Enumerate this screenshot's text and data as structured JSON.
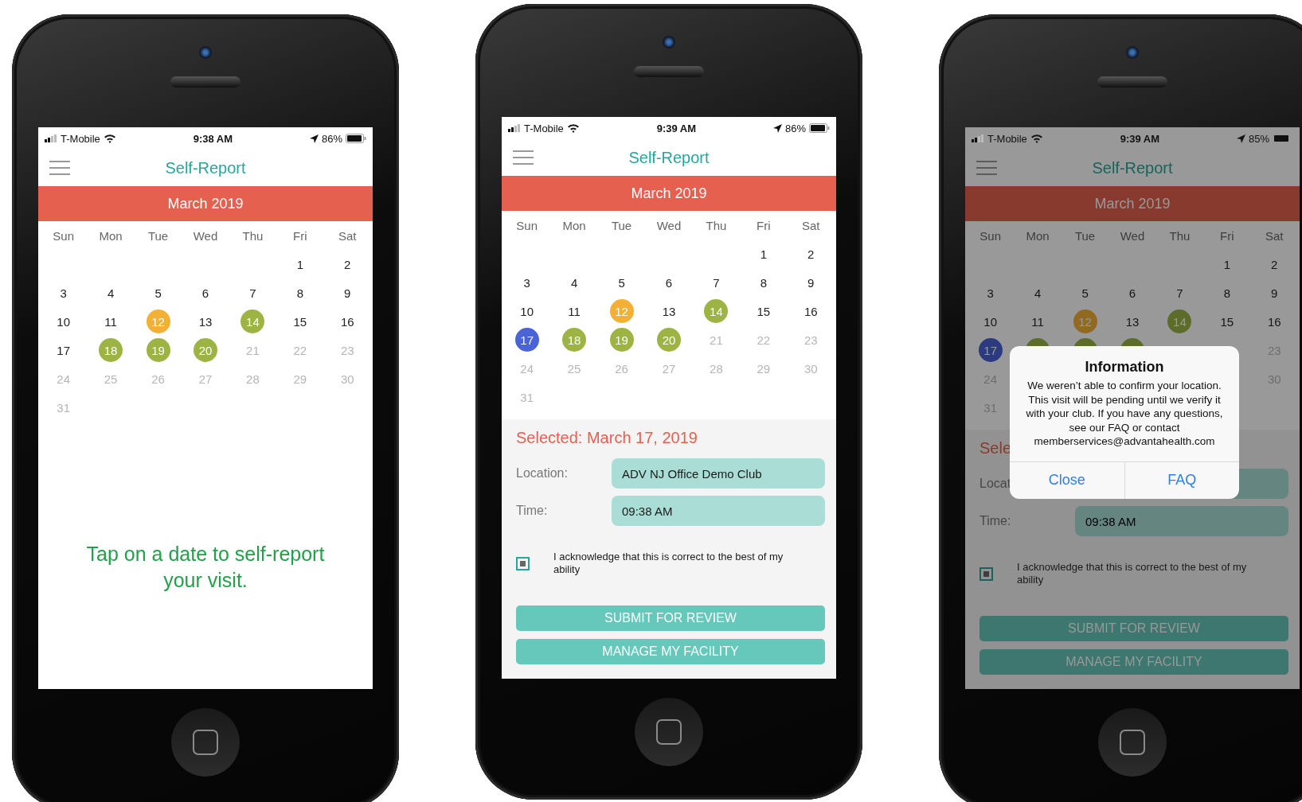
{
  "phones": [
    {
      "dimmed": false,
      "status_bar": {
        "carrier": "T-Mobile",
        "time": "9:38 AM",
        "battery": "86%"
      },
      "title": "Self-Report",
      "month": "March 2019",
      "weekdays": [
        "Sun",
        "Mon",
        "Tue",
        "Wed",
        "Thu",
        "Fri",
        "Sat"
      ],
      "weeks": [
        [
          {
            "kind": "blank"
          },
          {
            "kind": "blank"
          },
          {
            "kind": "blank"
          },
          {
            "kind": "blank"
          },
          {
            "kind": "blank"
          },
          {
            "kind": "date",
            "label": "1",
            "muted": false
          },
          {
            "kind": "date",
            "label": "2",
            "muted": false
          }
        ],
        [
          {
            "kind": "date",
            "label": "3",
            "muted": false
          },
          {
            "kind": "date",
            "label": "4",
            "muted": false
          },
          {
            "kind": "date",
            "label": "5",
            "muted": false
          },
          {
            "kind": "date",
            "label": "6",
            "muted": false
          },
          {
            "kind": "date",
            "label": "7",
            "muted": false
          },
          {
            "kind": "date",
            "label": "8",
            "muted": false
          },
          {
            "kind": "date",
            "label": "9",
            "muted": false
          }
        ],
        [
          {
            "kind": "date",
            "label": "10",
            "muted": false
          },
          {
            "kind": "date",
            "label": "11",
            "muted": false
          },
          {
            "kind": "date",
            "label": "12",
            "color": "#f2b135"
          },
          {
            "kind": "date",
            "label": "13",
            "muted": false
          },
          {
            "kind": "date",
            "label": "14",
            "color": "#9db444"
          },
          {
            "kind": "date",
            "label": "15",
            "muted": false
          },
          {
            "kind": "date",
            "label": "16",
            "muted": false
          }
        ],
        [
          {
            "kind": "date",
            "label": "17",
            "muted": false
          },
          {
            "kind": "date",
            "label": "18",
            "color": "#9db444"
          },
          {
            "kind": "date",
            "label": "19",
            "color": "#9db444"
          },
          {
            "kind": "date",
            "label": "20",
            "color": "#9db444"
          },
          {
            "kind": "date",
            "label": "21",
            "muted": true
          },
          {
            "kind": "date",
            "label": "22",
            "muted": true
          },
          {
            "kind": "date",
            "label": "23",
            "muted": true
          }
        ],
        [
          {
            "kind": "date",
            "label": "24",
            "muted": true
          },
          {
            "kind": "date",
            "label": "25",
            "muted": true
          },
          {
            "kind": "date",
            "label": "26",
            "muted": true
          },
          {
            "kind": "date",
            "label": "27",
            "muted": true
          },
          {
            "kind": "date",
            "label": "28",
            "muted": true
          },
          {
            "kind": "date",
            "label": "29",
            "muted": true
          },
          {
            "kind": "date",
            "label": "30",
            "muted": true
          }
        ],
        [
          {
            "kind": "date",
            "label": "31",
            "muted": true
          }
        ]
      ],
      "prompt": "Tap on a date to self-report your visit."
    },
    {
      "dimmed": false,
      "status_bar": {
        "carrier": "T-Mobile",
        "time": "9:39 AM",
        "battery": "86%"
      },
      "title": "Self-Report",
      "month": "March 2019",
      "weekdays": [
        "Sun",
        "Mon",
        "Tue",
        "Wed",
        "Thu",
        "Fri",
        "Sat"
      ],
      "weeks": [
        [
          {
            "kind": "blank"
          },
          {
            "kind": "blank"
          },
          {
            "kind": "blank"
          },
          {
            "kind": "blank"
          },
          {
            "kind": "blank"
          },
          {
            "kind": "date",
            "label": "1",
            "muted": false
          },
          {
            "kind": "date",
            "label": "2",
            "muted": false
          }
        ],
        [
          {
            "kind": "date",
            "label": "3",
            "muted": false
          },
          {
            "kind": "date",
            "label": "4",
            "muted": false
          },
          {
            "kind": "date",
            "label": "5",
            "muted": false
          },
          {
            "kind": "date",
            "label": "6",
            "muted": false
          },
          {
            "kind": "date",
            "label": "7",
            "muted": false
          },
          {
            "kind": "date",
            "label": "8",
            "muted": false
          },
          {
            "kind": "date",
            "label": "9",
            "muted": false
          }
        ],
        [
          {
            "kind": "date",
            "label": "10",
            "muted": false
          },
          {
            "kind": "date",
            "label": "11",
            "muted": false
          },
          {
            "kind": "date",
            "label": "12",
            "color": "#f2b135"
          },
          {
            "kind": "date",
            "label": "13",
            "muted": false
          },
          {
            "kind": "date",
            "label": "14",
            "color": "#9db444"
          },
          {
            "kind": "date",
            "label": "15",
            "muted": false
          },
          {
            "kind": "date",
            "label": "16",
            "muted": false
          }
        ],
        [
          {
            "kind": "date",
            "label": "17",
            "color": "#4a63d6"
          },
          {
            "kind": "date",
            "label": "18",
            "color": "#9db444"
          },
          {
            "kind": "date",
            "label": "19",
            "color": "#9db444"
          },
          {
            "kind": "date",
            "label": "20",
            "color": "#9db444"
          },
          {
            "kind": "date",
            "label": "21",
            "muted": true
          },
          {
            "kind": "date",
            "label": "22",
            "muted": true
          },
          {
            "kind": "date",
            "label": "23",
            "muted": true
          }
        ],
        [
          {
            "kind": "date",
            "label": "24",
            "muted": true
          },
          {
            "kind": "date",
            "label": "25",
            "muted": true
          },
          {
            "kind": "date",
            "label": "26",
            "muted": true
          },
          {
            "kind": "date",
            "label": "27",
            "muted": true
          },
          {
            "kind": "date",
            "label": "28",
            "muted": true
          },
          {
            "kind": "date",
            "label": "29",
            "muted": true
          },
          {
            "kind": "date",
            "label": "30",
            "muted": true
          }
        ],
        [
          {
            "kind": "date",
            "label": "31",
            "muted": true
          }
        ]
      ],
      "selection": {
        "heading": "Selected: March 17, 2019",
        "fields": [
          {
            "label": "Location:",
            "value": "ADV NJ Office Demo Club"
          },
          {
            "label": "Time:",
            "value": "09:38 AM"
          }
        ],
        "acknowledgement": {
          "checked": true,
          "text": "I acknowledge that this is correct to the best of my ability"
        },
        "buttons": [
          "SUBMIT FOR REVIEW",
          "MANAGE MY FACILITY"
        ]
      }
    },
    {
      "dimmed": true,
      "status_bar": {
        "carrier": "T-Mobile",
        "time": "9:39 AM",
        "battery": "85%"
      },
      "title": "Self-Report",
      "month": "March 2019",
      "weekdays": [
        "Sun",
        "Mon",
        "Tue",
        "Wed",
        "Thu",
        "Fri",
        "Sat"
      ],
      "weeks": [
        [
          {
            "kind": "blank"
          },
          {
            "kind": "blank"
          },
          {
            "kind": "blank"
          },
          {
            "kind": "blank"
          },
          {
            "kind": "blank"
          },
          {
            "kind": "date",
            "label": "1",
            "muted": false
          },
          {
            "kind": "date",
            "label": "2",
            "muted": false
          }
        ],
        [
          {
            "kind": "date",
            "label": "3",
            "muted": false
          },
          {
            "kind": "date",
            "label": "4",
            "muted": false
          },
          {
            "kind": "date",
            "label": "5",
            "muted": false
          },
          {
            "kind": "date",
            "label": "6",
            "muted": false
          },
          {
            "kind": "date",
            "label": "7",
            "muted": false
          },
          {
            "kind": "date",
            "label": "8",
            "muted": false
          },
          {
            "kind": "date",
            "label": "9",
            "muted": false
          }
        ],
        [
          {
            "kind": "date",
            "label": "10",
            "muted": false
          },
          {
            "kind": "date",
            "label": "11",
            "muted": false
          },
          {
            "kind": "date",
            "label": "12",
            "color": "#916a20"
          },
          {
            "kind": "date",
            "label": "13",
            "muted": false
          },
          {
            "kind": "date",
            "label": "14",
            "color": "#5e6c29"
          },
          {
            "kind": "date",
            "label": "15",
            "muted": false
          },
          {
            "kind": "date",
            "label": "16",
            "muted": false
          }
        ],
        [
          {
            "kind": "date",
            "label": "17",
            "color": "#2c3b80"
          },
          {
            "kind": "marker",
            "color": "#5e6c29"
          },
          {
            "kind": "marker",
            "color": "#5e6c29"
          },
          {
            "kind": "marker",
            "color": "#5e6c29"
          },
          {
            "kind": "blank"
          },
          {
            "kind": "blank"
          },
          {
            "kind": "date",
            "label": "23",
            "muted": true
          }
        ],
        [
          {
            "kind": "date",
            "label": "24",
            "muted": true
          },
          {
            "kind": "blank"
          },
          {
            "kind": "blank"
          },
          {
            "kind": "blank"
          },
          {
            "kind": "blank"
          },
          {
            "kind": "blank"
          },
          {
            "kind": "date",
            "label": "30",
            "muted": true
          }
        ],
        [
          {
            "kind": "date",
            "label": "31",
            "muted": true
          }
        ]
      ],
      "selection": {
        "heading": "Sele",
        "fields": [
          {
            "label": "Locat"
          },
          {
            "label": "Time:",
            "value": "09:38 AM"
          }
        ],
        "acknowledgement": {
          "checked": true,
          "text": "I acknowledge that this is correct to the best of my ability"
        },
        "buttons": [
          "SUBMIT FOR REVIEW",
          "MANAGE MY FACILITY"
        ]
      },
      "dialog": {
        "title": "Information",
        "message": "We weren’t able to confirm your location. This visit will be pending until we verify it with your club. If you have any questions, see our FAQ or contact memberservices@advantahealth.com",
        "buttons": [
          "Close",
          "FAQ"
        ]
      }
    }
  ]
}
